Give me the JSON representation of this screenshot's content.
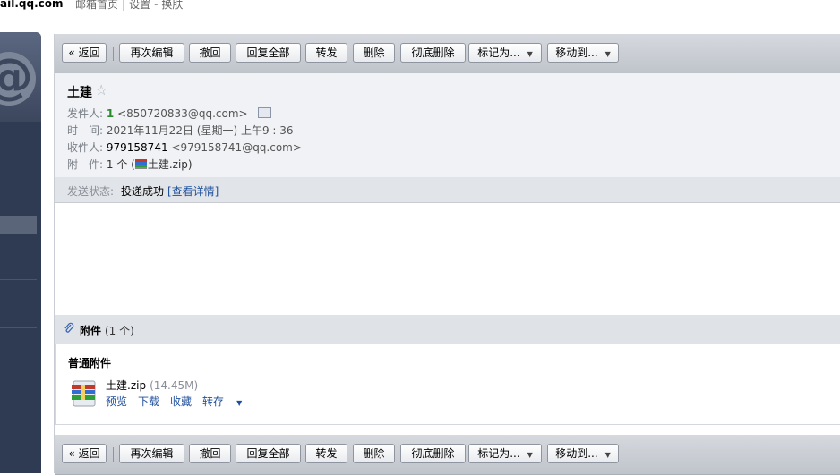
{
  "header": {
    "domain": "ail.qq.com",
    "links": [
      "邮箱首页",
      "设置",
      "换肤"
    ],
    "separators": [
      "|",
      "-"
    ]
  },
  "toolbar": {
    "back": "« 返回",
    "reedit": "再次编辑",
    "recall": "撤回",
    "reply_all": "回复全部",
    "forward": "转发",
    "delete": "删除",
    "delete_perm": "彻底删除",
    "mark_as": "标记为...",
    "move_to": "移动到..."
  },
  "mail": {
    "subject": "土建",
    "star": "☆",
    "sender_label": "发件人:",
    "sender_name": "1",
    "sender_email": "<850720833@qq.com>",
    "time_label": "时　间:",
    "time_value": "2021年11月22日 (星期一) 上午9 : 36",
    "recipient_label": "收件人:",
    "recipient_name": "979158741",
    "recipient_email": "<979158741@qq.com>",
    "attach_label": "附　件:",
    "attach_count_pre": "1 个 (",
    "attach_name": "土建.zip",
    "attach_count_post": ")"
  },
  "status": {
    "label": "发送状态:",
    "value": "投递成功",
    "link": "[查看详情]"
  },
  "attachments": {
    "title": "附件",
    "count": "(1 个)",
    "type_label": "普通附件",
    "file_name": "土建.zip",
    "file_size": "(14.45M)",
    "actions": {
      "preview": "预览",
      "download": "下载",
      "collect": "收藏",
      "save": "转存"
    }
  },
  "icons": {
    "paperclip": "paperclip-icon",
    "zip": "zip-file-icon",
    "star": "star-icon",
    "contact": "contact-card-icon",
    "caret": "caret-down-icon"
  }
}
